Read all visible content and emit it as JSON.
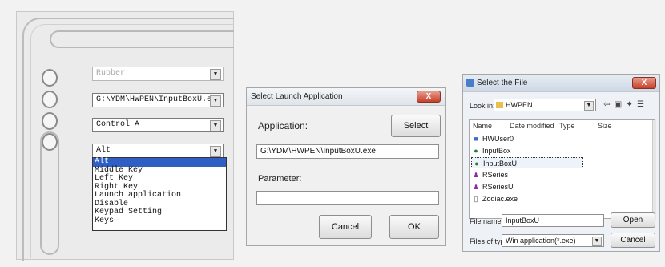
{
  "config_panel": {
    "selects": [
      {
        "value": "Rubber",
        "disabled": true
      },
      {
        "value": "G:\\YDM\\HWPEN\\InputBoxU.exe"
      },
      {
        "value": "Control A"
      },
      {
        "value": "Alt"
      }
    ],
    "dropdown_items": [
      "Alt",
      "Middle Key",
      "Left Key",
      "Right Key",
      "Launch application",
      "Disable",
      "Keypad Setting",
      "Keys—"
    ],
    "highlighted_index": 0
  },
  "launch_dialog": {
    "title": "Select Launch Application",
    "close_label": "X",
    "application_label": "Application:",
    "select_button": "Select",
    "application_path": "G:\\YDM\\HWPEN\\InputBoxU.exe",
    "parameter_label": "Parameter:",
    "parameter_value": "",
    "cancel_button": "Cancel",
    "ok_button": "OK"
  },
  "file_dialog": {
    "title": "Select the File",
    "close_label": "X",
    "look_in_label": "Look in:",
    "look_in_value": "HWPEN",
    "columns": [
      "Name",
      "Date modified",
      "Type",
      "Size"
    ],
    "files": [
      {
        "name": "HWUser0",
        "icon": "app-icon",
        "color": "#3a6bd0"
      },
      {
        "name": "InputBox",
        "icon": "app-icon",
        "color": "#2c7a3a"
      },
      {
        "name": "InputBoxU",
        "icon": "app-icon",
        "color": "#2c7a3a",
        "selected": true
      },
      {
        "name": "RSeries",
        "icon": "app-icon",
        "color": "#8a2f9c"
      },
      {
        "name": "RSeriesU",
        "icon": "app-icon",
        "color": "#8a2f9c"
      },
      {
        "name": "Zodiac.exe",
        "icon": "file-icon",
        "color": "#555555"
      }
    ],
    "file_name_label": "File name:",
    "file_name_value": "InputBoxU",
    "file_type_label": "Files of type:",
    "file_type_value": "Win application(*.exe)",
    "open_button": "Open",
    "cancel_button": "Cancel"
  }
}
